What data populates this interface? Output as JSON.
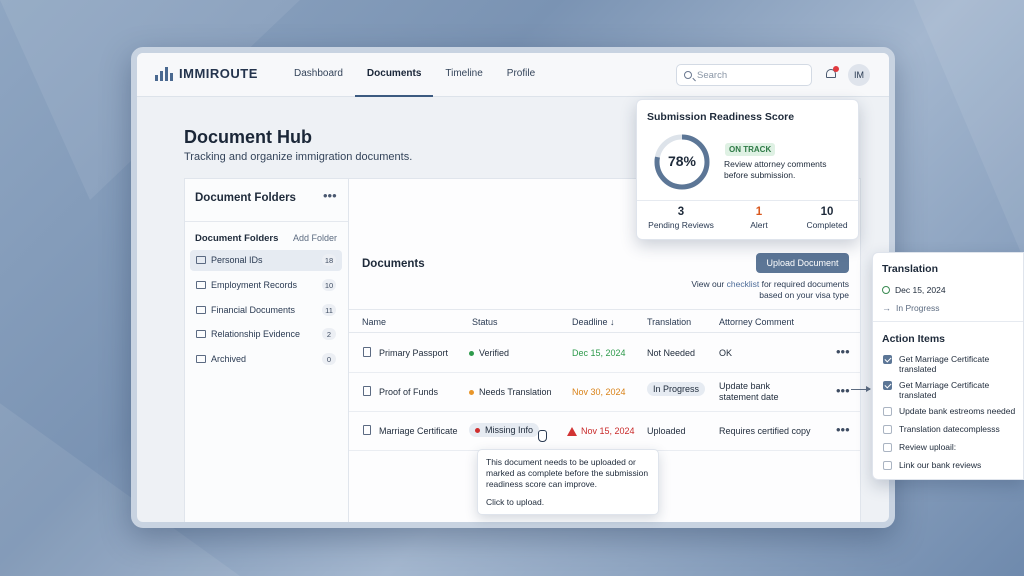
{
  "app": {
    "name": "IMMIROUTE"
  },
  "nav": [
    {
      "label": "Dashboard",
      "active": false
    },
    {
      "label": "Documents",
      "active": true
    },
    {
      "label": "Timeline",
      "active": false
    },
    {
      "label": "Profile",
      "active": false
    }
  ],
  "search": {
    "placeholder": "Search"
  },
  "user": {
    "initials": "IM"
  },
  "hub": {
    "title": "Document Hub",
    "subtitle": "Tracking and organize immigration documents."
  },
  "folders": {
    "title": "Document Folders",
    "more": "•••",
    "section_title": "Document Folders",
    "add_label": "Add Folder",
    "items": [
      {
        "label": "Personal IDs",
        "count": "18"
      },
      {
        "label": "Employment Records",
        "count": "10"
      },
      {
        "label": "Financial Documents",
        "count": "11"
      },
      {
        "label": "Relationship Evidence",
        "count": "2"
      },
      {
        "label": "Archived",
        "count": "0"
      }
    ]
  },
  "documents": {
    "title": "Documents",
    "upload_label": "Upload Document",
    "hint_prefix": "View our ",
    "hint_link": "checklist",
    "hint_suffix": " for required documents based on your visa type",
    "columns": {
      "name": "Name",
      "status": "Status",
      "deadline": "Deadline ↓",
      "translation": "Translation",
      "comment": "Attorney Comment"
    },
    "rows": [
      {
        "name": "Primary Passport",
        "status": "Verified",
        "status_color": "#2e9a4c",
        "deadline": "Dec 15, 2024",
        "deadline_color": "#2e9a4c",
        "translation": "Not Needed",
        "comment": "OK"
      },
      {
        "name": "Proof of Funds",
        "status": "Needs Translation",
        "status_color": "#e8962a",
        "deadline": "Nov 30, 2024",
        "deadline_color": "#d98218",
        "translation": "In Progress",
        "comment": "Update bank statement date"
      },
      {
        "name": "Marriage Certificate",
        "status": "Missing Info",
        "status_color": "#cf2e2e",
        "deadline": "Nov 15, 2024",
        "deadline_color": "#c92a2a",
        "translation": "Uploaded",
        "comment": "Requires certified copy"
      }
    ],
    "more": "•••"
  },
  "tooltip": {
    "text": "This document needs to be uploaded or marked as complete before the submission readiness score can improve.",
    "cta": "Click to upload."
  },
  "score": {
    "title": "Submission Readiness Score",
    "value_text": "78%",
    "value": 0.78,
    "badge": "ON TRACK",
    "message": "Review attorney comments before submission.",
    "stats": [
      {
        "value": "3",
        "label": "Pending Reviews",
        "color": "#1e2a3a"
      },
      {
        "value": "1",
        "label": "Alert",
        "color": "#d9581e"
      },
      {
        "value": "10",
        "label": "Completed",
        "color": "#1e2a3a"
      }
    ]
  },
  "panel": {
    "translation_title": "Translation",
    "date": "Dec 15, 2024",
    "progress": "In Progress",
    "actions_title": "Action Items",
    "actions": [
      {
        "label": "Get Marriage Certificate translated",
        "checked": true
      },
      {
        "label": "Get Marriage Certificate translated",
        "checked": true
      },
      {
        "label": "Update bank estreoms needed",
        "checked": false
      },
      {
        "label": "Translation datecomplesss",
        "checked": false
      },
      {
        "label": "Review uploail:",
        "checked": false
      },
      {
        "label": "Link our bank reviews",
        "checked": false
      }
    ]
  },
  "colors": {
    "accent": "#5c7696",
    "gauge_track": "#dde3ea"
  }
}
